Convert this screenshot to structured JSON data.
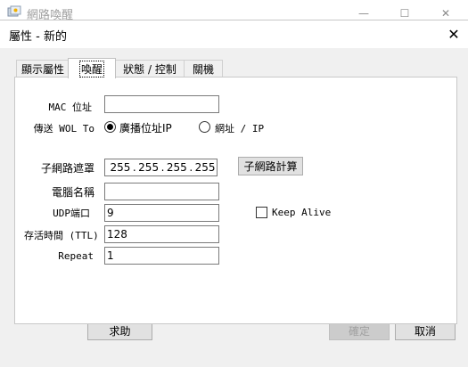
{
  "main_window": {
    "title": "網路喚醒",
    "controls": {
      "minimize": "—",
      "maximize": "☐",
      "close": "✕"
    }
  },
  "dialog": {
    "title": "屬性 - 新的",
    "close_glyph": "✕",
    "tabs": [
      {
        "label": "顯示屬性"
      },
      {
        "label": "喚醒"
      },
      {
        "label": "狀態 / 控制"
      },
      {
        "label": "關機"
      }
    ],
    "form": {
      "mac_label": "MAC 位址",
      "mac_value": "",
      "wol_label": "傳送 WOL To",
      "radio_broadcast": "廣播位址IP",
      "radio_ip": "網址 / IP",
      "subnet_label": "子網路遮罩",
      "subnet": [
        "255",
        "255",
        "255",
        "255"
      ],
      "subnet_calc_button": "子網路計算",
      "computer_name_label": "電腦名稱",
      "computer_name_value": "",
      "udp_label": "UDP端口",
      "udp_value": "9",
      "keep_alive_label": "Keep Alive",
      "ttl_label": "存活時間 (TTL)",
      "ttl_value": "128",
      "repeat_label": "Repeat",
      "repeat_value": "1"
    },
    "buttons": {
      "help": "求助",
      "ok": "確定",
      "cancel": "取消"
    }
  },
  "colors": {
    "window_bg": "#f0f0f0",
    "panel_bg": "#ffffff",
    "button_bg": "#e1e1e1"
  }
}
